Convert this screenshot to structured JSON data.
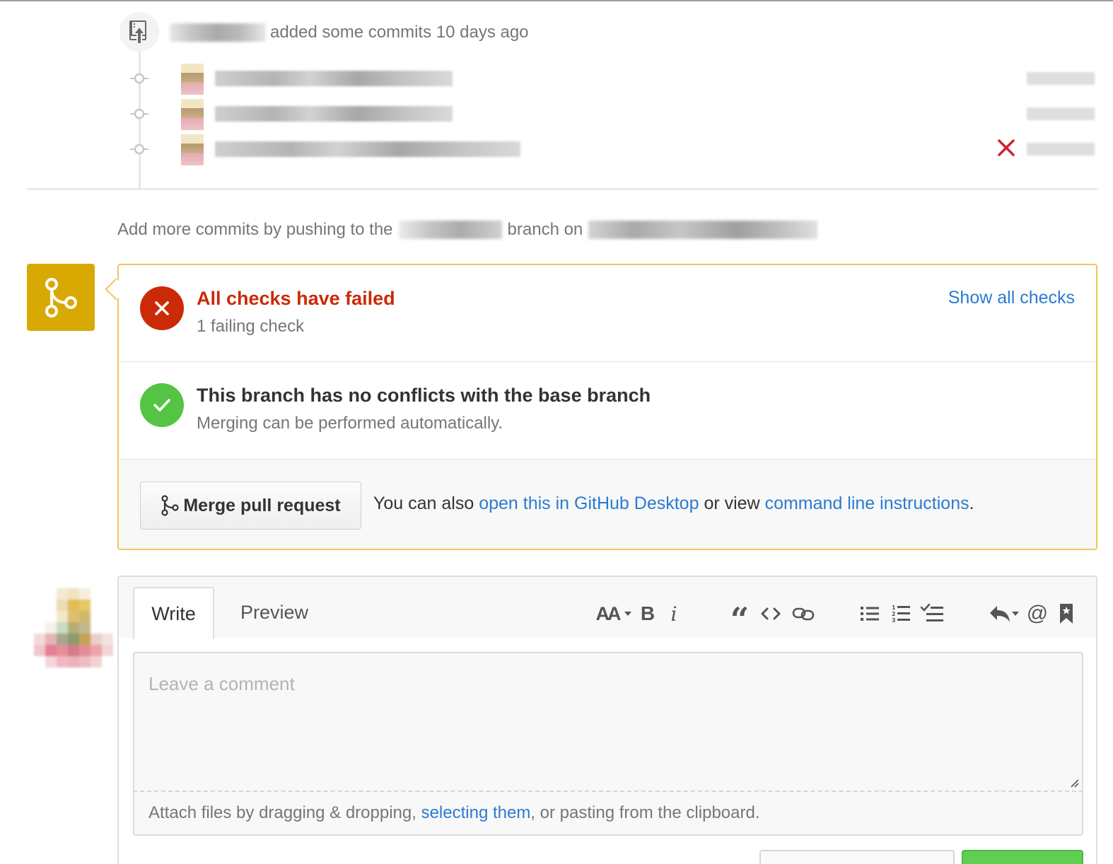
{
  "timeline": {
    "event_text": "added some commits 10 days ago",
    "commits": [
      {
        "status": ""
      },
      {
        "status": ""
      },
      {
        "status": "failed"
      }
    ]
  },
  "push_hint": {
    "prefix": "Add more commits by pushing to the",
    "middle": "branch on"
  },
  "merge": {
    "checks_title": "All checks have failed",
    "checks_subtitle": "1 failing check",
    "show_all_link": "Show all checks",
    "conflicts_title": "This branch has no conflicts with the base branch",
    "conflicts_subtitle": "Merging can be performed automatically.",
    "merge_button_label": "Merge pull request",
    "alt_prefix": "You can also",
    "alt_desktop_link": "open this in GitHub Desktop",
    "alt_middle": "or view",
    "alt_cli_link": "command line instructions",
    "alt_suffix": ".",
    "colors": {
      "fail": "#cb2a06",
      "success": "#55c344",
      "warning": "#d8a903",
      "link": "#2b7bd1"
    }
  },
  "editor": {
    "tab_write": "Write",
    "tab_preview": "Preview",
    "placeholder": "Leave a comment",
    "attach_prefix": "Attach files by dragging & dropping,",
    "attach_link": "selecting them",
    "attach_suffix": ", or pasting from the clipboard.",
    "toolbar_icons": [
      "text-size-icon",
      "bold-icon",
      "italic-icon",
      "quote-icon",
      "code-icon",
      "link-icon",
      "bullet-list-icon",
      "numbered-list-icon",
      "task-list-icon",
      "reply-icon",
      "mention-icon",
      "bookmark-icon"
    ],
    "toolbar_labels": {
      "text_size": "AA",
      "bold": "B",
      "italic": "i",
      "quote": "“",
      "mention": "@"
    }
  }
}
